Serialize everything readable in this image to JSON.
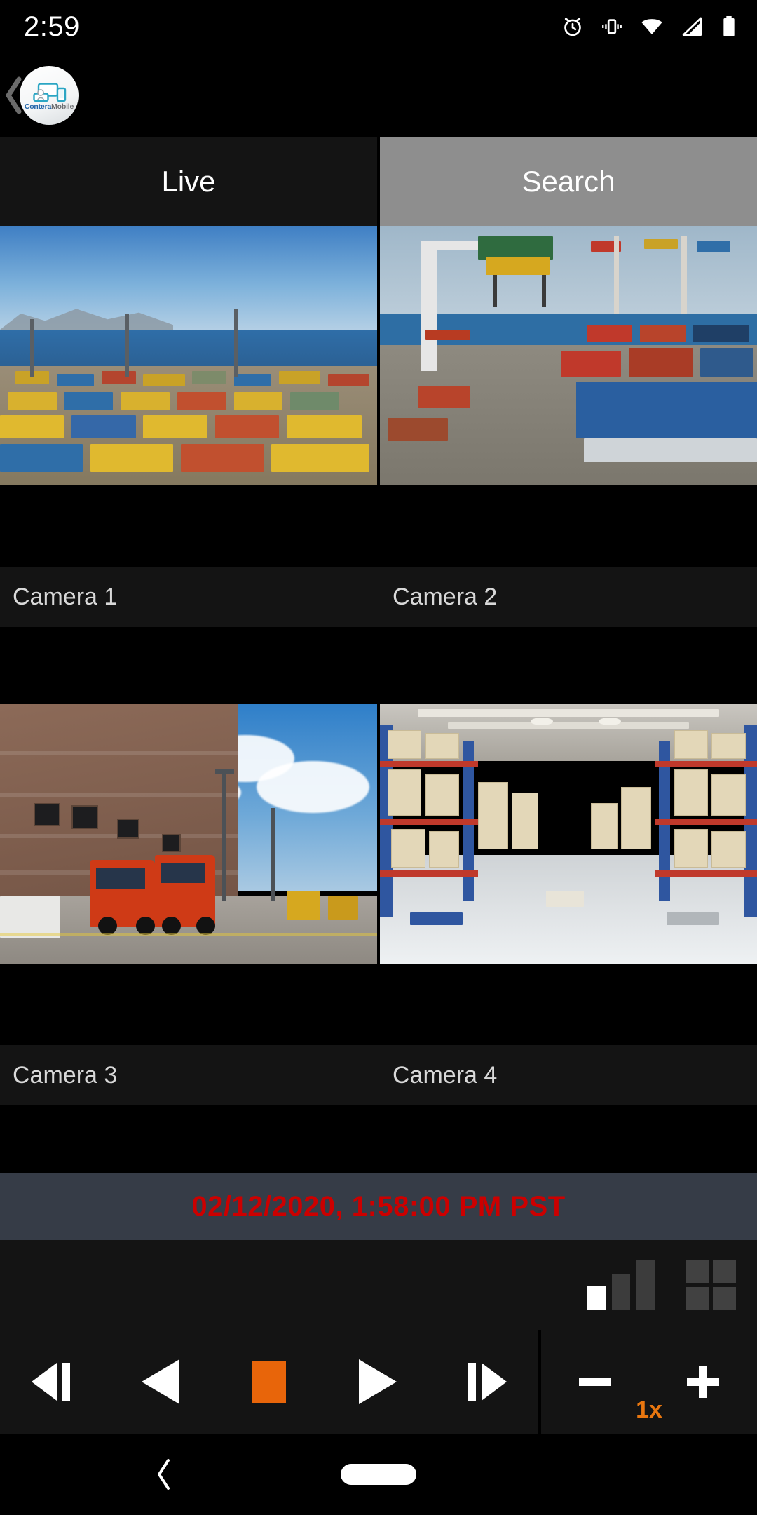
{
  "status_bar": {
    "clock": "2:59",
    "icons": [
      "alarm-icon",
      "vibrate-icon",
      "wifi-icon",
      "cellular-signal-icon",
      "battery-icon"
    ]
  },
  "app_bar": {
    "back_label": "‹",
    "logo": {
      "brand_primary": "Contera",
      "brand_secondary": "Mobile",
      "mark": "monitor-person-icon",
      "accent": "#2ba6c4"
    }
  },
  "tabs": [
    {
      "label": "Live",
      "active": true
    },
    {
      "label": "Search",
      "active": false
    }
  ],
  "cameras": [
    {
      "label": "Camera 1",
      "scene": "port-container-yard"
    },
    {
      "label": "Camera 2",
      "scene": "port-crane-containers"
    },
    {
      "label": "Camera 3",
      "scene": "loading-dock-trucks"
    },
    {
      "label": "Camera 4",
      "scene": "warehouse-aisle"
    }
  ],
  "timestamp": {
    "text": "02/12/2020, 1:58:00 PM PST",
    "color": "#cc0000"
  },
  "toolbar": {
    "signal_icon": "signal-strength-icon",
    "signal_active_bars": 1,
    "signal_total_bars": 3,
    "layout_icon": "grid-layout-2x2-icon"
  },
  "playback": {
    "buttons": [
      {
        "name": "step-backward-button",
        "icon": "step-backward-icon"
      },
      {
        "name": "rewind-button",
        "icon": "rewind-icon"
      },
      {
        "name": "stop-button",
        "icon": "stop-square-icon",
        "color": "#e8650a"
      },
      {
        "name": "play-button",
        "icon": "play-icon"
      },
      {
        "name": "step-forward-button",
        "icon": "step-forward-icon"
      }
    ]
  },
  "zoom_control": {
    "minus_label": "−",
    "plus_label": "+",
    "level": "1x",
    "level_color": "#e8760f"
  },
  "nav_bar": {
    "back_icon": "nav-back-icon",
    "home_icon": "nav-home-pill-icon"
  }
}
